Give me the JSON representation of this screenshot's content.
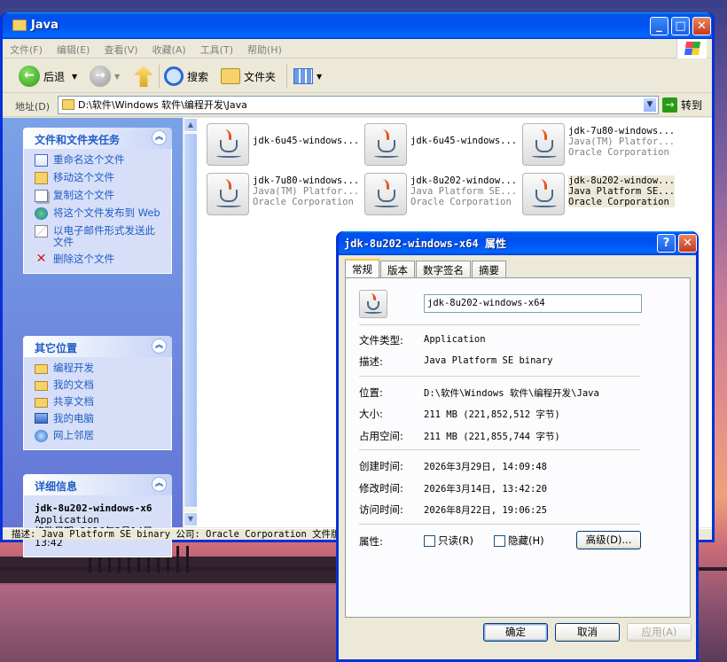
{
  "window": {
    "title": "Java",
    "menu": [
      "文件(F)",
      "编辑(E)",
      "查看(V)",
      "收藏(A)",
      "工具(T)",
      "帮助(H)"
    ],
    "toolbar": {
      "back": "后退",
      "search": "搜索",
      "folders": "文件夹"
    },
    "address": {
      "label": "地址(D)",
      "value": "D:\\软件\\Windows 软件\\编程开发\\Java",
      "go": "转到"
    },
    "tasks_panel": {
      "title": "文件和文件夹任务",
      "items": [
        "重命名这个文件",
        "移动这个文件",
        "复制这个文件",
        "将这个文件发布到 Web",
        "以电子邮件形式发送此文件",
        "删除这个文件"
      ]
    },
    "places_panel": {
      "title": "其它位置",
      "items": [
        "编程开发",
        "我的文档",
        "共享文档",
        "我的电脑",
        "网上邻居"
      ]
    },
    "details_panel": {
      "title": "详细信息",
      "name": "jdk-8u202-windows-x6",
      "type": "Application",
      "modified": "修改日期: 2026年3月14日, 13:42"
    },
    "files": [
      {
        "name": "jdk-6u45-windows...",
        "sub1": "",
        "sub2": ""
      },
      {
        "name": "jdk-6u45-windows...",
        "sub1": "",
        "sub2": ""
      },
      {
        "name": "jdk-7u80-windows...",
        "sub1": "Java(TM) Platfor...",
        "sub2": "Oracle Corporation"
      },
      {
        "name": "jdk-7u80-windows...",
        "sub1": "Java(TM) Platfor...",
        "sub2": "Oracle Corporation"
      },
      {
        "name": "jdk-8u202-window...",
        "sub1": "Java Platform SE...",
        "sub2": "Oracle Corporation"
      },
      {
        "name": "jdk-8u202-window...",
        "sub1": "Java Platform SE...",
        "sub2": "Oracle Corporation"
      }
    ],
    "status": "描述: Java Platform SE binary 公司: Oracle Corporation 文件版本"
  },
  "dialog": {
    "title": "jdk-8u202-windows-x64 属性",
    "tabs": [
      "常规",
      "版本",
      "数字签名",
      "摘要"
    ],
    "filename": "jdk-8u202-windows-x64",
    "labels": {
      "type": "文件类型:",
      "desc": "描述:",
      "location": "位置:",
      "size": "大小:",
      "disk": "占用空间:",
      "created": "创建时间:",
      "modified": "修改时间:",
      "accessed": "访问时间:",
      "attrs": "属性:"
    },
    "values": {
      "type": "Application",
      "desc": "Java Platform SE binary",
      "location": "D:\\软件\\Windows 软件\\编程开发\\Java",
      "size": "211 MB (221,852,512 字节)",
      "disk": "211 MB (221,855,744 字节)",
      "created": "2026年3月29日, 14:09:48",
      "modified": "2026年3月14日, 13:42:20",
      "accessed": "2026年8月22日, 19:06:25"
    },
    "readonly": "只读(R)",
    "hidden": "隐藏(H)",
    "advanced": "高级(D)...",
    "ok": "确定",
    "cancel": "取消",
    "apply": "应用(A)"
  }
}
